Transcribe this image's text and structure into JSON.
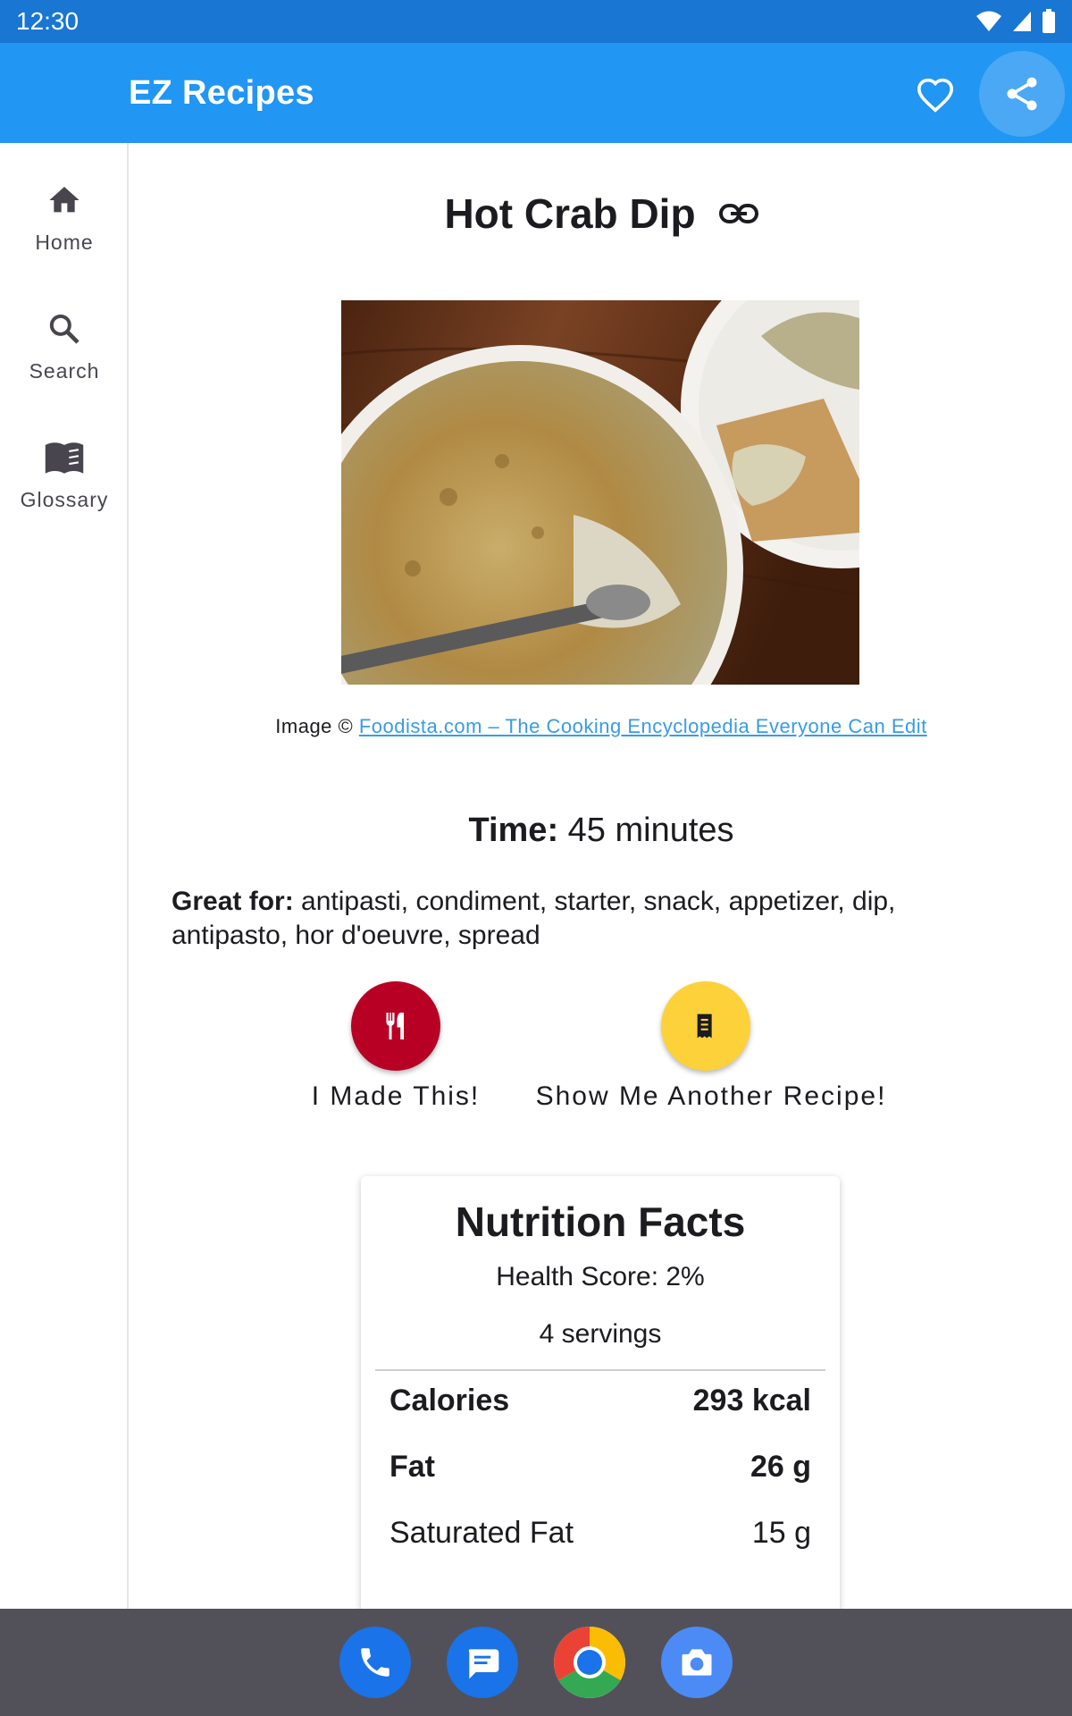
{
  "status_bar": {
    "time": "12:30"
  },
  "app_bar": {
    "title": "EZ Recipes"
  },
  "nav": {
    "items": [
      {
        "label": "Home",
        "icon": "home-icon"
      },
      {
        "label": "Search",
        "icon": "search-icon"
      },
      {
        "label": "Glossary",
        "icon": "book-icon"
      }
    ]
  },
  "recipe": {
    "title": "Hot Crab Dip",
    "credit_prefix": "Image ©",
    "credit_link": "Foodista.com – The Cooking Encyclopedia Everyone Can Edit",
    "time_label": "Time:",
    "time_value": "45 minutes",
    "great_for_label": "Great for:",
    "great_for_value": "antipasti, condiment, starter, snack, appetizer, dip, antipasto, hor d'oeuvre, spread",
    "made_this_label": "I Made This!",
    "another_label": "Show Me Another Recipe!"
  },
  "nutrition": {
    "title": "Nutrition Facts",
    "health_score": "Health Score: 2%",
    "servings": "4 servings",
    "rows": [
      {
        "name": "Calories",
        "value": "293 kcal",
        "bold": true
      },
      {
        "name": "Fat",
        "value": "26 g",
        "bold": true
      },
      {
        "name": "Saturated Fat",
        "value": "15 g",
        "bold": false
      }
    ]
  },
  "colors": {
    "status_bar": "#1976d2",
    "app_bar": "#2196f3",
    "made_fab": "#b80024",
    "another_fab": "#fdd13a",
    "link": "#3a9be5",
    "taskbar": "#525159"
  },
  "dock": [
    "phone-icon",
    "messages-icon",
    "chrome-icon",
    "camera-icon"
  ]
}
